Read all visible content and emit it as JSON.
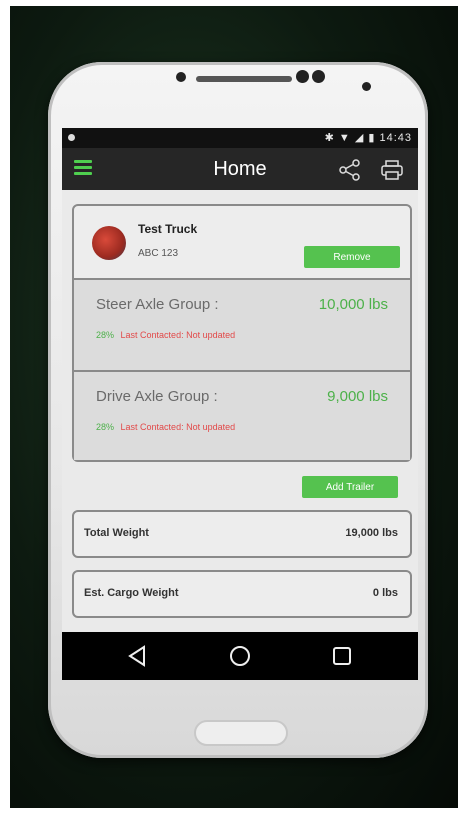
{
  "status_bar": {
    "time": "14:43"
  },
  "app_bar": {
    "title": "Home"
  },
  "truck": {
    "name": "Test Truck",
    "plate": "ABC 123",
    "remove_label": "Remove"
  },
  "axles": [
    {
      "label": "Steer Axle Group :",
      "value": "10,000 lbs",
      "status_pct": "28%",
      "status_text": "Last Contacted: Not updated"
    },
    {
      "label": "Drive Axle Group :",
      "value": "9,000 lbs",
      "status_pct": "28%",
      "status_text": "Last Contacted: Not updated"
    }
  ],
  "add_trailer_label": "Add Trailer",
  "summary": {
    "total_label": "Total Weight",
    "total_value": "19,000 lbs",
    "cargo_label": "Est. Cargo Weight",
    "cargo_value": "0 lbs"
  },
  "colors": {
    "accent_green": "#55c24f",
    "value_green": "#4db14a",
    "status_red": "#e24a4a",
    "app_bar": "#262626"
  },
  "icons": {
    "menu": "hamburger-menu-icon",
    "share": "share-icon",
    "print": "printer-icon",
    "back": "back-triangle-icon",
    "home": "home-circle-icon",
    "recent": "recent-apps-square-icon"
  }
}
